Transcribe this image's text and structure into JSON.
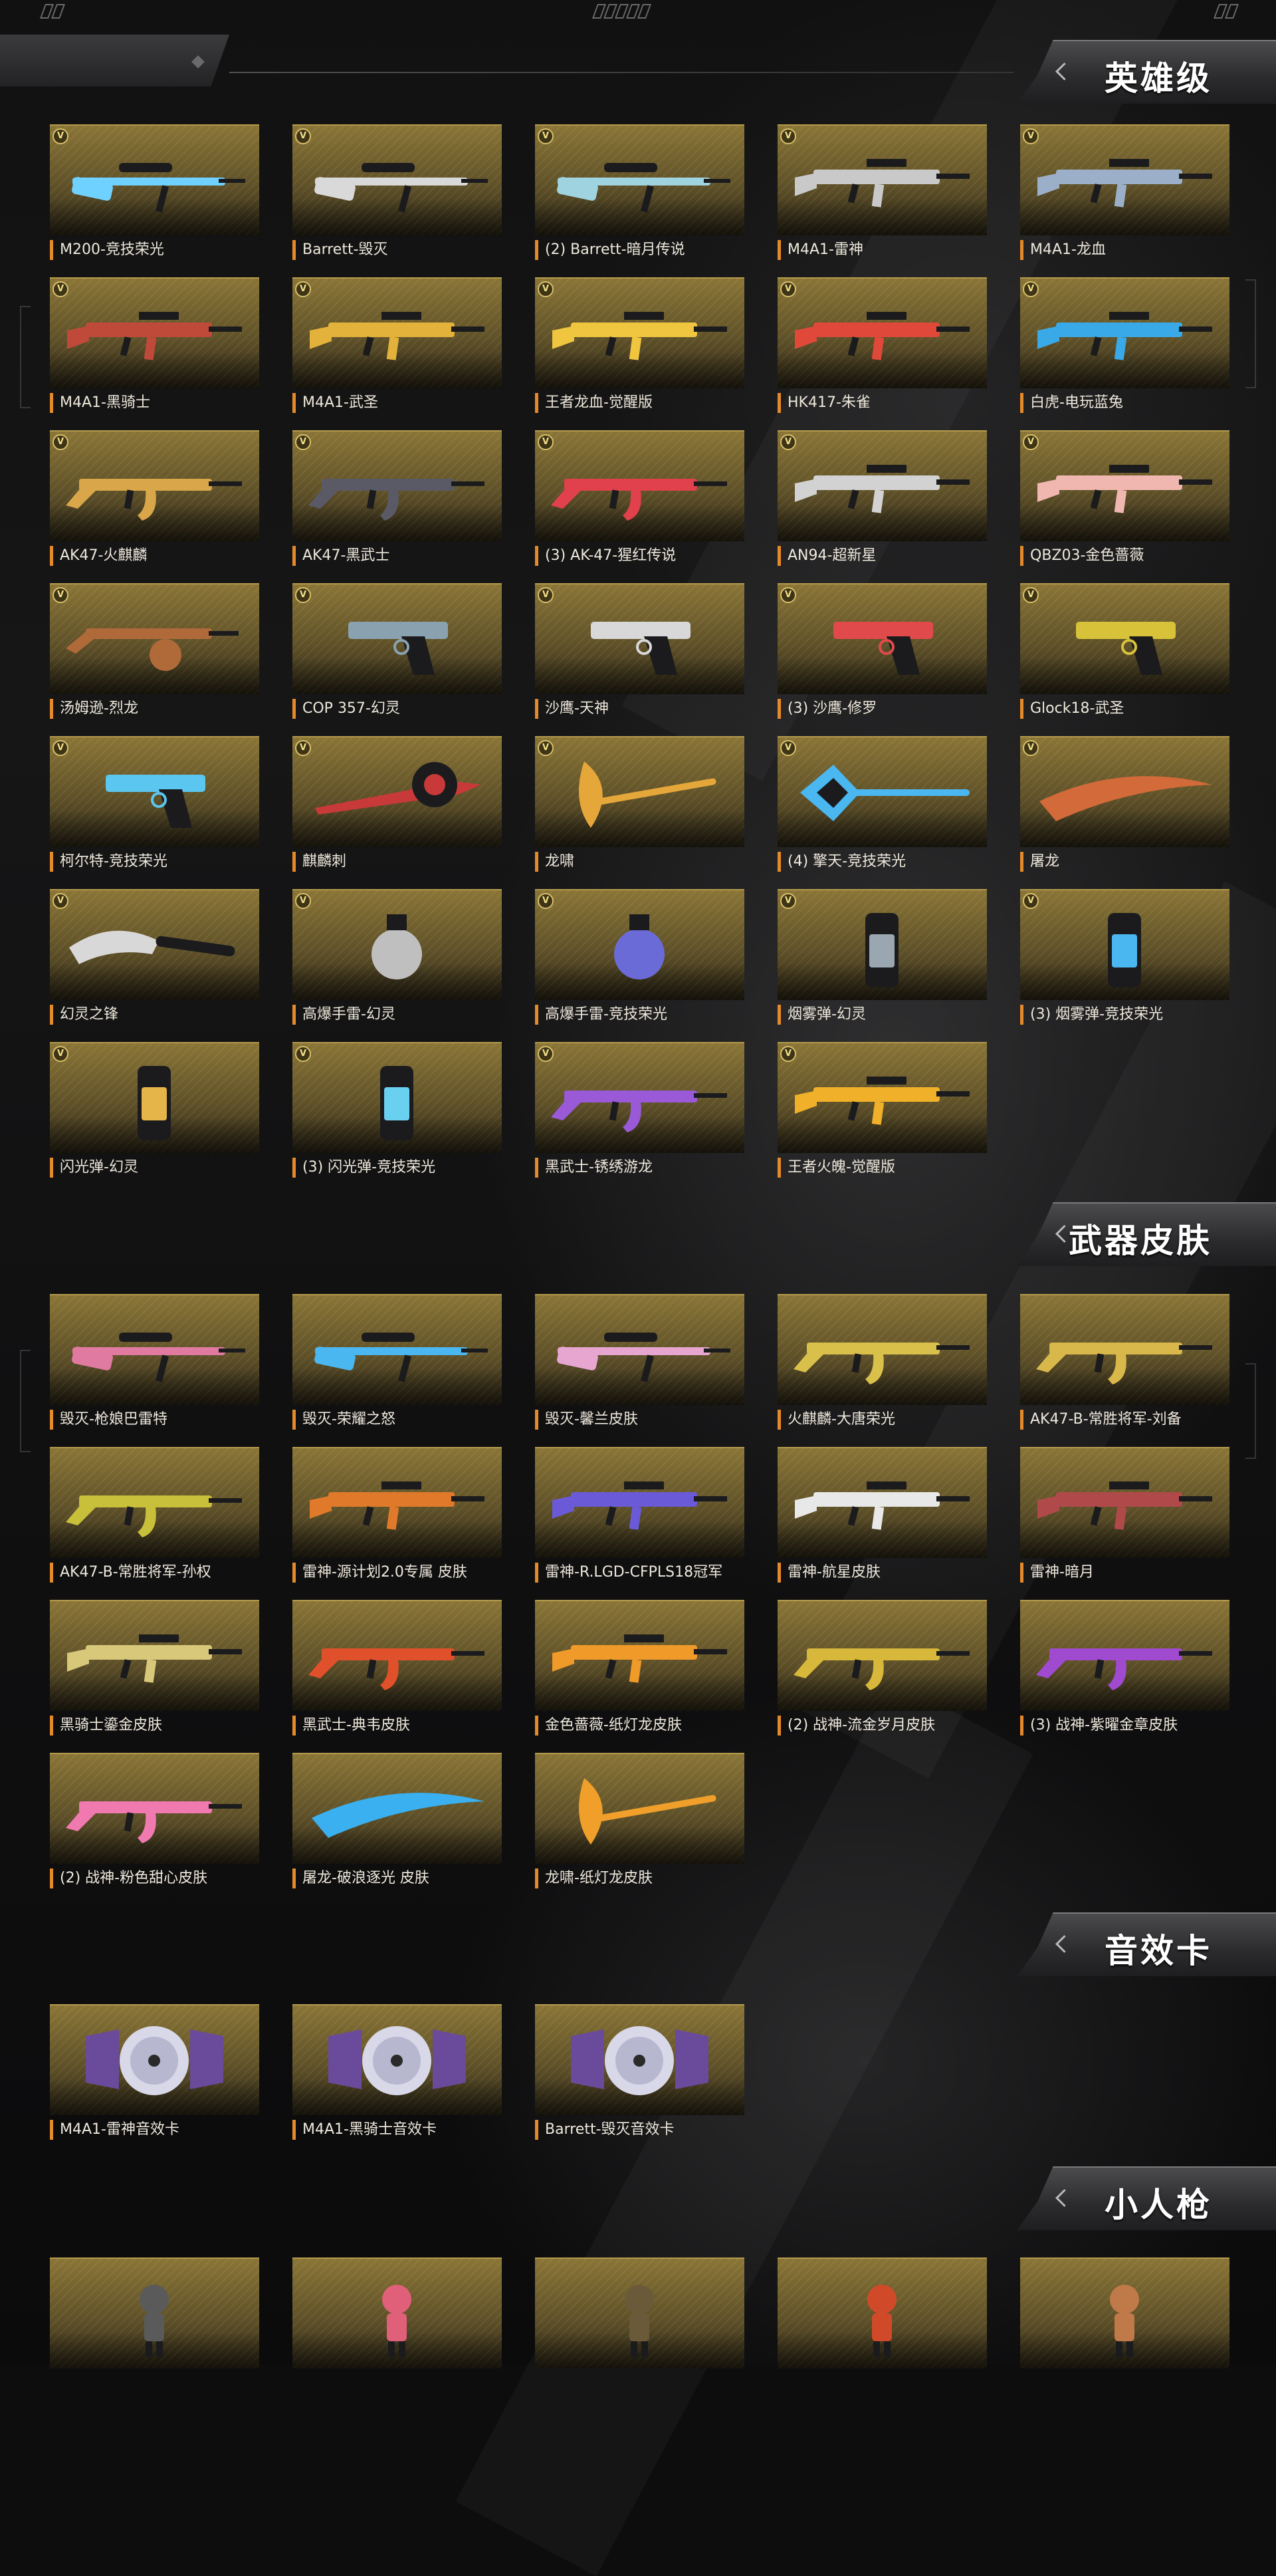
{
  "colors": {
    "accent": "#e58a2a",
    "tile_gold": "#8a7536",
    "header_text": "#ffffff"
  },
  "sections": [
    {
      "title": "英雄级",
      "badge": "V",
      "items": [
        {
          "label": "M200-竞技荣光",
          "icon": "sniper-rifle-icon",
          "color": "#6fd1ff"
        },
        {
          "label": "Barrett-毁灭",
          "icon": "sniper-rifle-icon",
          "color": "#d9d9d9"
        },
        {
          "label": "(2) Barrett-暗月传说",
          "icon": "sniper-rifle-icon",
          "color": "#9fd3e0"
        },
        {
          "label": "M4A1-雷神",
          "icon": "assault-rifle-icon",
          "color": "#c9c9c9"
        },
        {
          "label": "M4A1-龙血",
          "icon": "assault-rifle-icon",
          "color": "#9bb0c8"
        },
        {
          "label": "M4A1-黑骑士",
          "icon": "assault-rifle-icon",
          "color": "#c04a3a"
        },
        {
          "label": "M4A1-武圣",
          "icon": "assault-rifle-icon",
          "color": "#e3b23a"
        },
        {
          "label": "王者龙血-觉醒版",
          "icon": "assault-rifle-icon",
          "color": "#f0c540"
        },
        {
          "label": "HK417-朱雀",
          "icon": "assault-rifle-icon",
          "color": "#e0483a"
        },
        {
          "label": "白虎-电玩蓝兔",
          "icon": "assault-rifle-icon",
          "color": "#3aa9e8"
        },
        {
          "label": "AK47-火麒麟",
          "icon": "ak-rifle-icon",
          "color": "#d9a64a"
        },
        {
          "label": "AK47-黑武士",
          "icon": "ak-rifle-icon",
          "color": "#5a5a66"
        },
        {
          "label": "(3) AK-47-猩红传说",
          "icon": "ak-rifle-icon",
          "color": "#e0414c"
        },
        {
          "label": "AN94-超新星",
          "icon": "assault-rifle-icon",
          "color": "#d2d2d2"
        },
        {
          "label": "QBZ03-金色蔷薇",
          "icon": "assault-rifle-icon",
          "color": "#f0b7b0"
        },
        {
          "label": "汤姆逊-烈龙",
          "icon": "smg-icon",
          "color": "#b06a3a"
        },
        {
          "label": "COP 357-幻灵",
          "icon": "pistol-icon",
          "color": "#8aa2b0"
        },
        {
          "label": "沙鹰-天神",
          "icon": "pistol-icon",
          "color": "#d8d8d8"
        },
        {
          "label": "(3) 沙鹰-修罗",
          "icon": "pistol-icon",
          "color": "#e14a4a"
        },
        {
          "label": "Glock18-武圣",
          "icon": "pistol-icon",
          "color": "#d7c23a"
        },
        {
          "label": "柯尔特-竞技荣光",
          "icon": "pistol-icon",
          "color": "#5bc6f0"
        },
        {
          "label": "麒麟刺",
          "icon": "melee-icon",
          "color": "#c83a3a"
        },
        {
          "label": "龙啸",
          "icon": "axe-icon",
          "color": "#e6a73a"
        },
        {
          "label": "(4) 擎天-竞技荣光",
          "icon": "shovel-icon",
          "color": "#4ab7f0"
        },
        {
          "label": "屠龙",
          "icon": "blade-icon",
          "color": "#d26a3a"
        },
        {
          "label": "幻灵之锋",
          "icon": "knife-icon",
          "color": "#d8d8d8"
        },
        {
          "label": "高爆手雷-幻灵",
          "icon": "grenade-icon",
          "color": "#bfbfbf"
        },
        {
          "label": "高爆手雷-竞技荣光",
          "icon": "grenade-icon",
          "color": "#6b6bd8"
        },
        {
          "label": "烟雾弹-幻灵",
          "icon": "canister-icon",
          "color": "#9aa6b0"
        },
        {
          "label": "(3) 烟雾弹-竞技荣光",
          "icon": "canister-icon",
          "color": "#4ab7f0"
        },
        {
          "label": "闪光弹-幻灵",
          "icon": "canister-icon",
          "color": "#e6b54a"
        },
        {
          "label": "(3) 闪光弹-竞技荣光",
          "icon": "canister-icon",
          "color": "#6ad0f0"
        },
        {
          "label": "黑武士-锈绣游龙",
          "icon": "ak-rifle-icon",
          "color": "#9a5ad8"
        },
        {
          "label": "王者火魄-觉醒版",
          "icon": "assault-rifle-icon",
          "color": "#f0b02a"
        }
      ]
    },
    {
      "title": "武器皮肤",
      "badge": "",
      "items": [
        {
          "label": "毁灭-枪娘巴雷特",
          "icon": "sniper-rifle-icon",
          "color": "#e07aa0"
        },
        {
          "label": "毁灭-荣耀之怒",
          "icon": "sniper-rifle-icon",
          "color": "#4ab7f0"
        },
        {
          "label": "毁灭-馨兰皮肤",
          "icon": "sniper-rifle-icon",
          "color": "#e6a6d0"
        },
        {
          "label": "火麒麟-大唐荣光",
          "icon": "ak-rifle-icon",
          "color": "#d9c04a"
        },
        {
          "label": "AK47-B-常胜将军-刘备",
          "icon": "ak-rifle-icon",
          "color": "#d8b84a"
        },
        {
          "label": "AK47-B-常胜将军-孙权",
          "icon": "ak-rifle-icon",
          "color": "#c8c03a"
        },
        {
          "label": "雷神-源计划2.0专属 皮肤",
          "icon": "assault-rifle-icon",
          "color": "#e07a2a"
        },
        {
          "label": "雷神-R.LGD-CFPLS18冠军",
          "icon": "assault-rifle-icon",
          "color": "#6b5ad8"
        },
        {
          "label": "雷神-航星皮肤",
          "icon": "assault-rifle-icon",
          "color": "#e8e8e8"
        },
        {
          "label": "雷神-暗月",
          "icon": "assault-rifle-icon",
          "color": "#b04a4a"
        },
        {
          "label": "黑骑士鎏金皮肤",
          "icon": "assault-rifle-icon",
          "color": "#d8c87a"
        },
        {
          "label": "黑武士-典韦皮肤",
          "icon": "ak-rifle-icon",
          "color": "#e0502a"
        },
        {
          "label": "金色蔷薇-纸灯龙皮肤",
          "icon": "assault-rifle-icon",
          "color": "#f09a2a"
        },
        {
          "label": "(2) 战神-流金岁月皮肤",
          "icon": "ak-rifle-icon",
          "color": "#d8b83a"
        },
        {
          "label": "(3) 战神-紫曜金章皮肤",
          "icon": "ak-rifle-icon",
          "color": "#a04ad0"
        },
        {
          "label": "(2) 战神-粉色甜心皮肤",
          "icon": "ak-rifle-icon",
          "color": "#f07ab0"
        },
        {
          "label": "屠龙-破浪逐光 皮肤",
          "icon": "blade-icon",
          "color": "#3ab0f0"
        },
        {
          "label": "龙啸-纸灯龙皮肤",
          "icon": "axe-icon",
          "color": "#f0a02a"
        }
      ]
    },
    {
      "title": "音效卡",
      "badge": "",
      "items": [
        {
          "label": "M4A1-雷神音效卡",
          "icon": "disc-icon",
          "color": "#d8d8e8"
        },
        {
          "label": "M4A1-黑骑士音效卡",
          "icon": "disc-icon",
          "color": "#d8d8e8"
        },
        {
          "label": "Barrett-毁灭音效卡",
          "icon": "disc-icon",
          "color": "#d8d8e8"
        }
      ]
    },
    {
      "title": "小人枪",
      "badge": "",
      "items": [
        {
          "label": "",
          "icon": "chibi-figure-icon",
          "color": "#5a5a5a"
        },
        {
          "label": "",
          "icon": "chibi-figure-icon",
          "color": "#e0607a"
        },
        {
          "label": "",
          "icon": "chibi-figure-icon",
          "color": "#6a5a3a"
        },
        {
          "label": "",
          "icon": "chibi-figure-icon",
          "color": "#d04a2a"
        },
        {
          "label": "",
          "icon": "chibi-figure-icon",
          "color": "#c07a4a"
        }
      ]
    }
  ]
}
